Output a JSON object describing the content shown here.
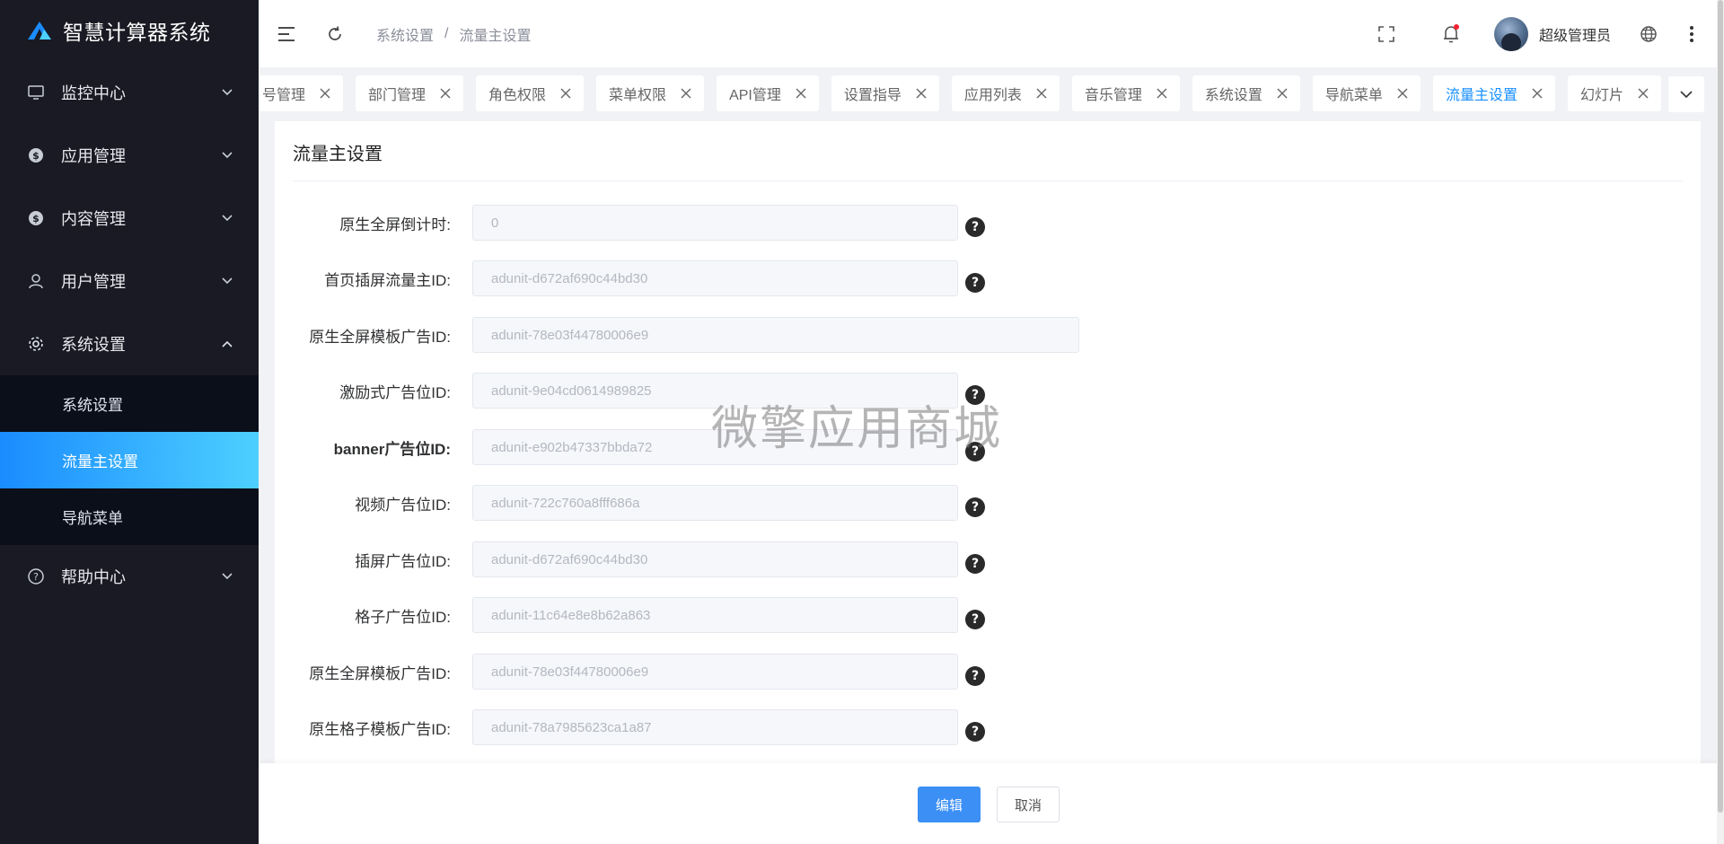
{
  "app": {
    "title": "智慧计算器系统",
    "accent": "#1890ff"
  },
  "sidebar": {
    "items": [
      {
        "label": "监控中心",
        "icon": "monitor-icon"
      },
      {
        "label": "应用管理",
        "icon": "dollar-icon"
      },
      {
        "label": "内容管理",
        "icon": "dollar-icon"
      },
      {
        "label": "用户管理",
        "icon": "user-icon"
      },
      {
        "label": "系统设置",
        "icon": "gear-icon",
        "expanded": true
      },
      {
        "label": "帮助中心",
        "icon": "question-circle-icon"
      }
    ],
    "submenu": [
      {
        "label": "系统设置",
        "active": false
      },
      {
        "label": "流量主设置",
        "active": true
      },
      {
        "label": "导航菜单",
        "active": false
      }
    ]
  },
  "header": {
    "breadcrumb": [
      "系统设置",
      "流量主设置"
    ],
    "breadcrumb_sep": "/",
    "user_name": "超级管理员"
  },
  "tabs": [
    {
      "label": "号管理"
    },
    {
      "label": "部门管理"
    },
    {
      "label": "角色权限"
    },
    {
      "label": "菜单权限"
    },
    {
      "label": "API管理"
    },
    {
      "label": "设置指导"
    },
    {
      "label": "应用列表"
    },
    {
      "label": "音乐管理"
    },
    {
      "label": "系统设置"
    },
    {
      "label": "导航菜单"
    },
    {
      "label": "流量主设置",
      "active": true
    },
    {
      "label": "幻灯片"
    }
  ],
  "page": {
    "title": "流量主设置",
    "watermark": "微擎应用商城",
    "fields": [
      {
        "label": "原生全屏倒计时:",
        "value": "0"
      },
      {
        "label": "首页插屏流量主ID:",
        "value": "adunit-d672af690c44bd30"
      },
      {
        "label": "原生全屏模板广告ID:",
        "value": "adunit-78e03f44780006e9"
      },
      {
        "label": "激励式广告位ID:",
        "value": "adunit-9e04cd0614989825"
      },
      {
        "label": "banner广告位ID:",
        "value": "adunit-e902b47337bbda72"
      },
      {
        "label": "视频广告位ID:",
        "value": "adunit-722c760a8fff686a"
      },
      {
        "label": "插屏广告位ID:",
        "value": "adunit-d672af690c44bd30"
      },
      {
        "label": "格子广告位ID:",
        "value": "adunit-11c64e8e8b62a863"
      },
      {
        "label": "原生全屏模板广告ID:",
        "value": "adunit-78e03f44780006e9"
      },
      {
        "label": "原生格子模板广告ID:",
        "value": "adunit-78a7985623ca1a87"
      }
    ]
  },
  "footer": {
    "edit_label": "编辑",
    "cancel_label": "取消"
  }
}
